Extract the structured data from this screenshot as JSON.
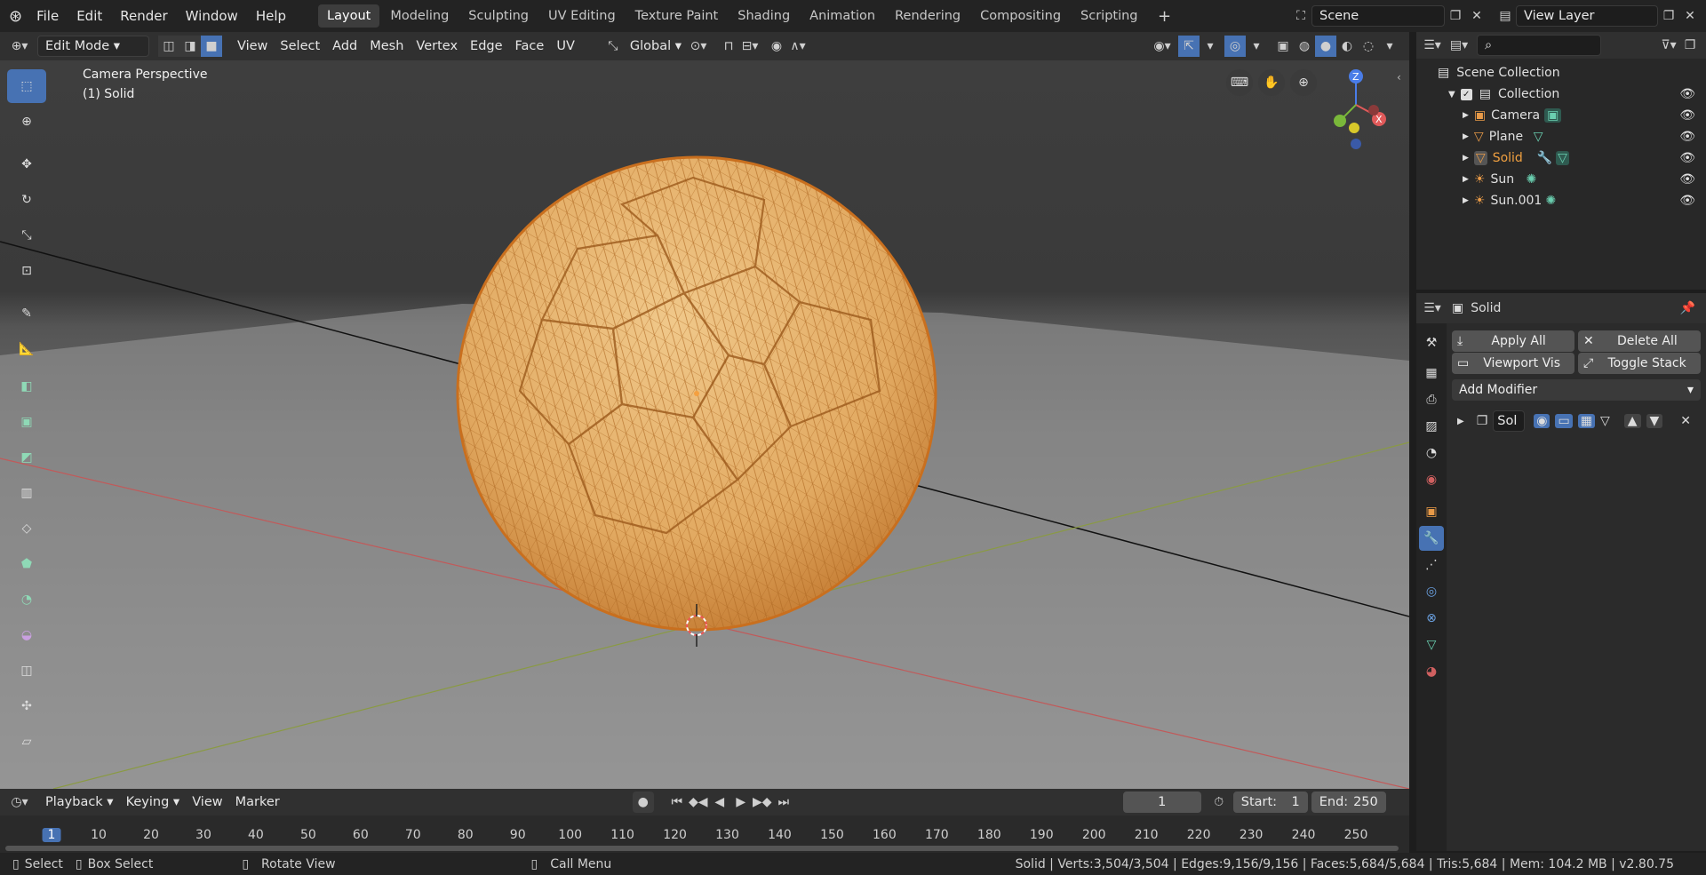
{
  "menus": [
    "File",
    "Edit",
    "Render",
    "Window",
    "Help"
  ],
  "workspaces": [
    "Layout",
    "Modeling",
    "Sculpting",
    "UV Editing",
    "Texture Paint",
    "Shading",
    "Animation",
    "Rendering",
    "Compositing",
    "Scripting"
  ],
  "active_workspace": "Layout",
  "scene": {
    "name": "Scene",
    "view_layer": "View Layer"
  },
  "header3d": {
    "mode": "Edit Mode",
    "menus": [
      "View",
      "Select",
      "Add",
      "Mesh",
      "Vertex",
      "Edge",
      "Face",
      "UV"
    ],
    "orientation": "Global"
  },
  "viewport": {
    "overlay_line1": "Camera Perspective",
    "overlay_line2": "(1) Solid",
    "gizmo": {
      "z": "Z",
      "x": "X"
    }
  },
  "outliner": {
    "root": "Scene Collection",
    "collection": "Collection",
    "items": [
      {
        "name": "Camera",
        "icon": "camera-icon"
      },
      {
        "name": "Plane",
        "icon": "mesh-icon"
      },
      {
        "name": "Solid",
        "icon": "mesh-icon",
        "active": true
      },
      {
        "name": "Sun",
        "icon": "light-icon"
      },
      {
        "name": "Sun.001",
        "icon": "light-icon"
      }
    ]
  },
  "properties": {
    "object": "Solid",
    "apply_all": "Apply All",
    "delete_all": "Delete All",
    "viewport_vis": "Viewport Vis",
    "toggle_stack": "Toggle Stack",
    "add_modifier": "Add Modifier",
    "modifier_name": "Sol"
  },
  "timeline": {
    "menus": [
      "Playback",
      "Keying",
      "View",
      "Marker"
    ],
    "current_frame": "1",
    "start_label": "Start:",
    "start": "1",
    "end_label": "End:",
    "end": "250",
    "ticks": [
      "1",
      "10",
      "20",
      "30",
      "40",
      "50",
      "60",
      "70",
      "80",
      "90",
      "100",
      "110",
      "120",
      "130",
      "140",
      "150",
      "160",
      "170",
      "180",
      "190",
      "200",
      "210",
      "220",
      "230",
      "240",
      "250"
    ]
  },
  "status": {
    "select": "Select",
    "box_select": "Box Select",
    "rotate": "Rotate View",
    "call_menu": "Call Menu",
    "stats": "Solid | Verts:3,504/3,504 | Edges:9,156/9,156 | Faces:5,684/5,684 | Tris:5,684 | Mem: 104.2 MB | v2.80.75"
  },
  "colors": {
    "accent": "#4772b3",
    "selection_orange": "#e8a060",
    "ball": "#e2aa62"
  }
}
